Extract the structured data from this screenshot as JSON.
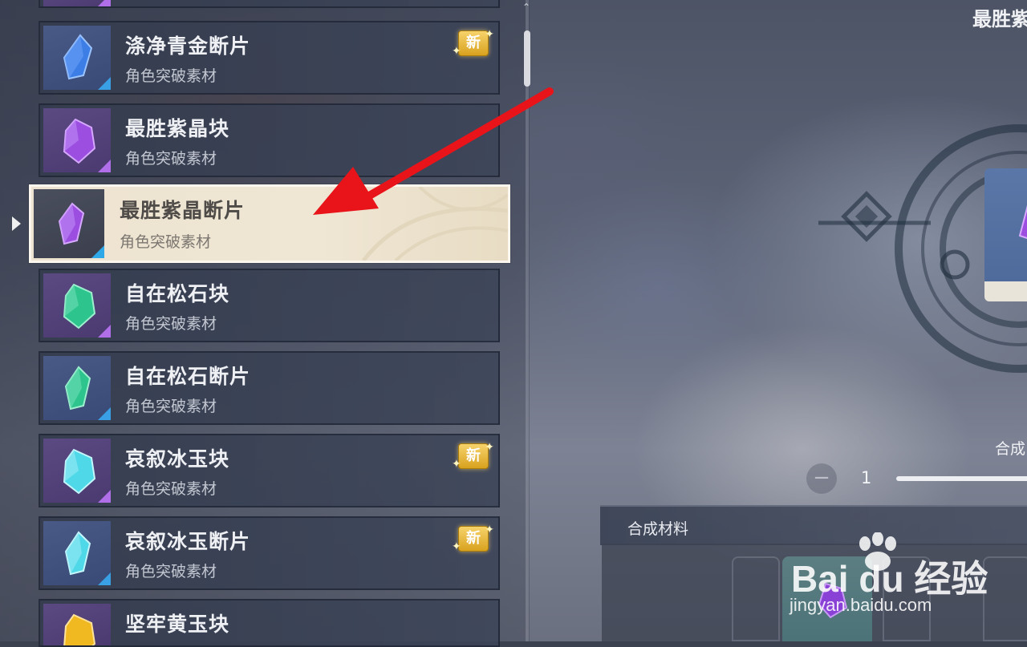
{
  "materials": [
    {
      "name": "涤净青金断片",
      "category": "角色突破素材",
      "new_badge": "新",
      "gem_color": "#3c7de6",
      "rarity": "blue"
    },
    {
      "name": "最胜紫晶块",
      "category": "角色突破素材",
      "new_badge": "",
      "gem_color": "#9b4ee0",
      "rarity": "purple"
    },
    {
      "name": "最胜紫晶断片",
      "category": "角色突破素材",
      "new_badge": "",
      "gem_color": "#9b4ee0",
      "rarity": "blue",
      "selected": true
    },
    {
      "name": "自在松石块",
      "category": "角色突破素材",
      "new_badge": "",
      "gem_color": "#2ec48e",
      "rarity": "purple"
    },
    {
      "name": "自在松石断片",
      "category": "角色突破素材",
      "new_badge": "",
      "gem_color": "#2ec48e",
      "rarity": "blue"
    },
    {
      "name": "哀叙冰玉块",
      "category": "角色突破素材",
      "new_badge": "新",
      "gem_color": "#4fd8e8",
      "rarity": "purple"
    },
    {
      "name": "哀叙冰玉断片",
      "category": "角色突破素材",
      "new_badge": "新",
      "gem_color": "#4fd8e8",
      "rarity": "blue"
    },
    {
      "name": "坚牢黄玉块",
      "category": "",
      "new_badge": "",
      "gem_color": "#f0b821",
      "rarity": "purple"
    }
  ],
  "detail": {
    "title": "最胜紫",
    "synth_label": "合成",
    "minus_symbol": "−",
    "quantity": "1",
    "materials_header": "合成材料"
  },
  "watermark": {
    "main": "Bai du 经验",
    "url": "jingyan.baidu.com"
  },
  "colors": {
    "selected_card": "#efe6d4",
    "annotation_arrow": "#e8141a",
    "new_badge": "#e3ad2a"
  }
}
